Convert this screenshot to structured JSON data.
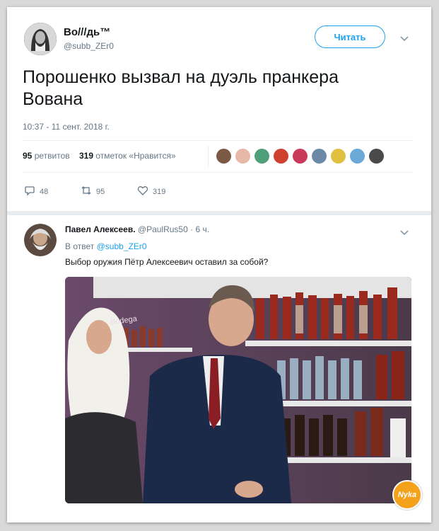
{
  "tweet": {
    "author_name": "Во///дь™",
    "author_handle": "@subb_ZEr0",
    "follow_label": "Читать",
    "text": "Порошенко вызвал на дуэль пранкера Вована",
    "timestamp": "10:37 - 11 сент. 2018 г.",
    "retweets_count": "95",
    "retweets_label": "ретвитов",
    "likes_count": "319",
    "likes_label": "отметок «Нравится»",
    "actions": {
      "replies": "48",
      "retweets": "95",
      "likes": "319"
    }
  },
  "reply": {
    "author_name": "Павел Алексеев.",
    "author_handle": "@PaulRus50",
    "time_ago": "· 6 ч.",
    "in_reply_prefix": "В ответ",
    "in_reply_handle": "@subb_ZEr0",
    "text": "Выбор оружия Пётр Алексеевич оставил за собой?",
    "photo_sign": "Bodega"
  },
  "watermark": "Nyka",
  "colors": {
    "accent": "#1da1f2",
    "muted": "#657786",
    "like": "#657786"
  }
}
